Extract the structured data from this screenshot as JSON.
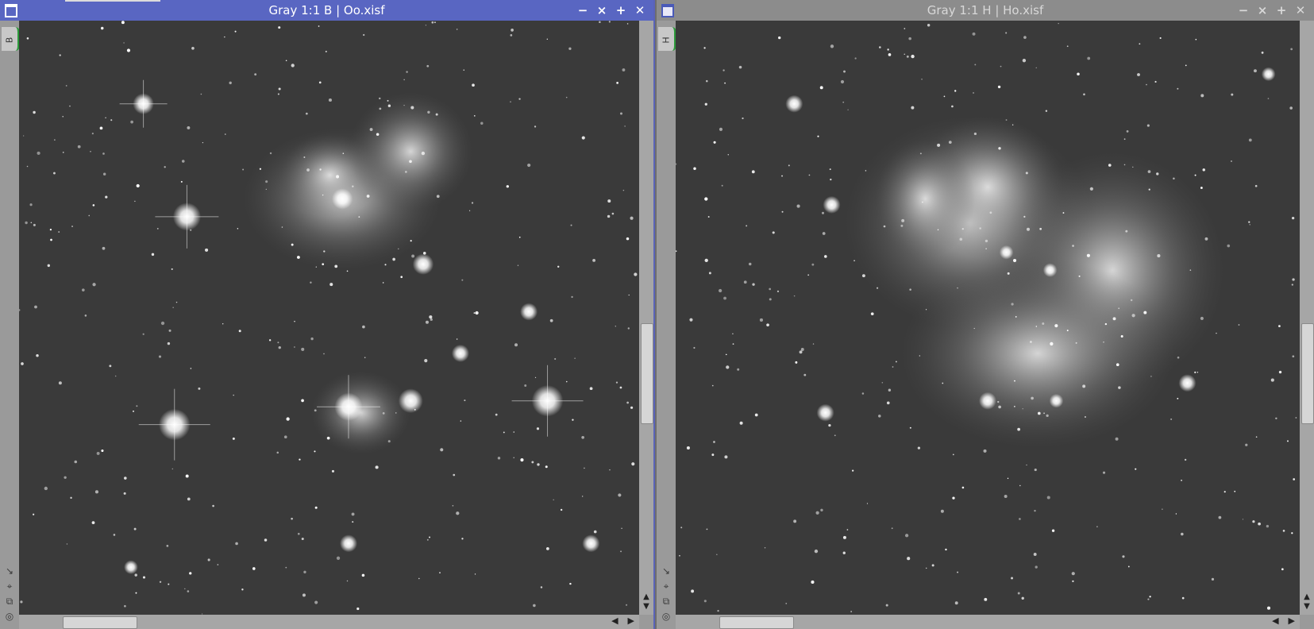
{
  "windows": [
    {
      "id": "left",
      "title": "Gray 1:1 B | Oo.xisf",
      "mask_tab": "B",
      "active": true,
      "controls": [
        "minimize-icon",
        "shade-icon",
        "maximize-icon",
        "close-icon"
      ]
    },
    {
      "id": "right",
      "title": "Gray 1:1 H | Ho.xisf",
      "mask_tab": "H",
      "active": false,
      "controls": [
        "minimize-icon",
        "shade-icon",
        "maximize-icon",
        "close-icon"
      ]
    }
  ],
  "glyphs": {
    "minimize": "−",
    "shade": "⨯",
    "maximize": "+",
    "close": "✕",
    "up": "▲",
    "down": "▼",
    "left": "◀",
    "right": "▶",
    "strip_1": "↘",
    "strip_2": "⌖",
    "strip_3": "⧉",
    "strip_4": "◎"
  },
  "colors": {
    "active_titlebar": "#5966c2",
    "inactive_titlebar": "#8c8c8c",
    "mask_tab_accent": "#2c9a3a"
  }
}
